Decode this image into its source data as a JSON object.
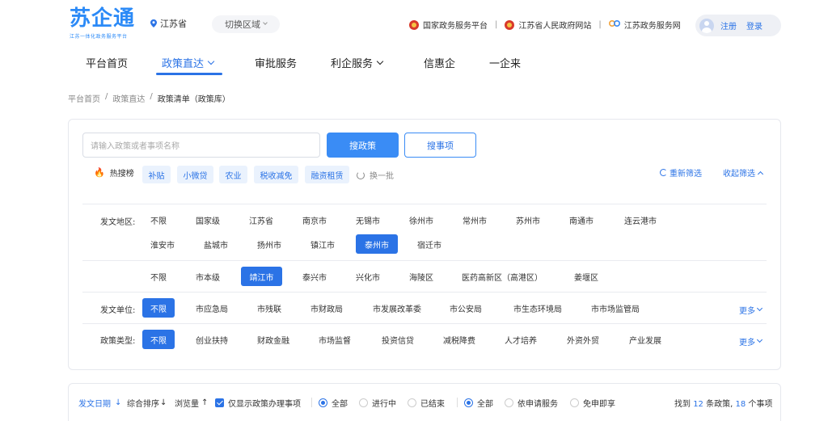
{
  "header": {
    "logo_main": "苏企通",
    "logo_sub": "江苏一体化政务服务平台",
    "location": "江苏省",
    "switch_region": "切换区域",
    "links": [
      "国家政务服务平台",
      "江苏省人民政府网站",
      "江苏政务服务网"
    ],
    "register": "注册",
    "login": "登录"
  },
  "nav": {
    "items": [
      "平台首页",
      "政策直达",
      "审批服务",
      "利企服务",
      "信惠企",
      "一企来"
    ],
    "active": "政策直达"
  },
  "breadcrumb": [
    "平台首页",
    "政策直达",
    "政策清单（政策库）"
  ],
  "search": {
    "placeholder": "请输入政策或者事项名称",
    "search_policy": "搜政策",
    "search_item": "搜事项"
  },
  "hot": {
    "label": "热搜榜",
    "tags": [
      "补贴",
      "小微贷",
      "农业",
      "税收减免",
      "融资租赁"
    ],
    "refresh": "换一批",
    "reset": "重新筛选",
    "collapse": "收起筛选"
  },
  "filters": {
    "region_label": "发文地区:",
    "region_row1": [
      "不限",
      "国家级",
      "江苏省",
      "南京市",
      "无锡市",
      "徐州市",
      "常州市",
      "苏州市",
      "南通市",
      "连云港市"
    ],
    "region_row2": [
      "淮安市",
      "盐城市",
      "扬州市",
      "镇江市",
      "泰州市",
      "宿迁市"
    ],
    "region_selected": "泰州市",
    "district_row": [
      "不限",
      "市本级",
      "靖江市",
      "泰兴市",
      "兴化市",
      "海陵区",
      "医药高新区（高港区）",
      "姜堰区"
    ],
    "district_selected": "靖江市",
    "unit_label": "发文单位:",
    "unit_options": [
      "不限",
      "市应急局",
      "市残联",
      "市财政局",
      "市发展改革委",
      "市公安局",
      "市生态环境局",
      "市市场监管局"
    ],
    "unit_selected": "不限",
    "type_label": "政策类型:",
    "type_options": [
      "不限",
      "创业扶持",
      "财政金融",
      "市场监督",
      "投资信贷",
      "减税降费",
      "人才培养",
      "外资外贸",
      "产业发展"
    ],
    "type_selected": "不限",
    "more": "更多"
  },
  "results_bar": {
    "sort_date": "发文日期",
    "sort_overall": "综合排序",
    "sort_views": "浏览量",
    "only_show": "仅显示政策办理事项",
    "status": [
      "全部",
      "进行中",
      "已结束"
    ],
    "service": [
      "全部",
      "依申请服务",
      "免申即享"
    ],
    "found_prefix": "找到",
    "policy_count": "12",
    "policy_suffix": "条政策,",
    "item_count": "18",
    "item_suffix": "个事项"
  },
  "colors": {
    "accent": "#2b73e6",
    "button": "#3a8cf5",
    "tag_bg": "#eaf2fd"
  }
}
